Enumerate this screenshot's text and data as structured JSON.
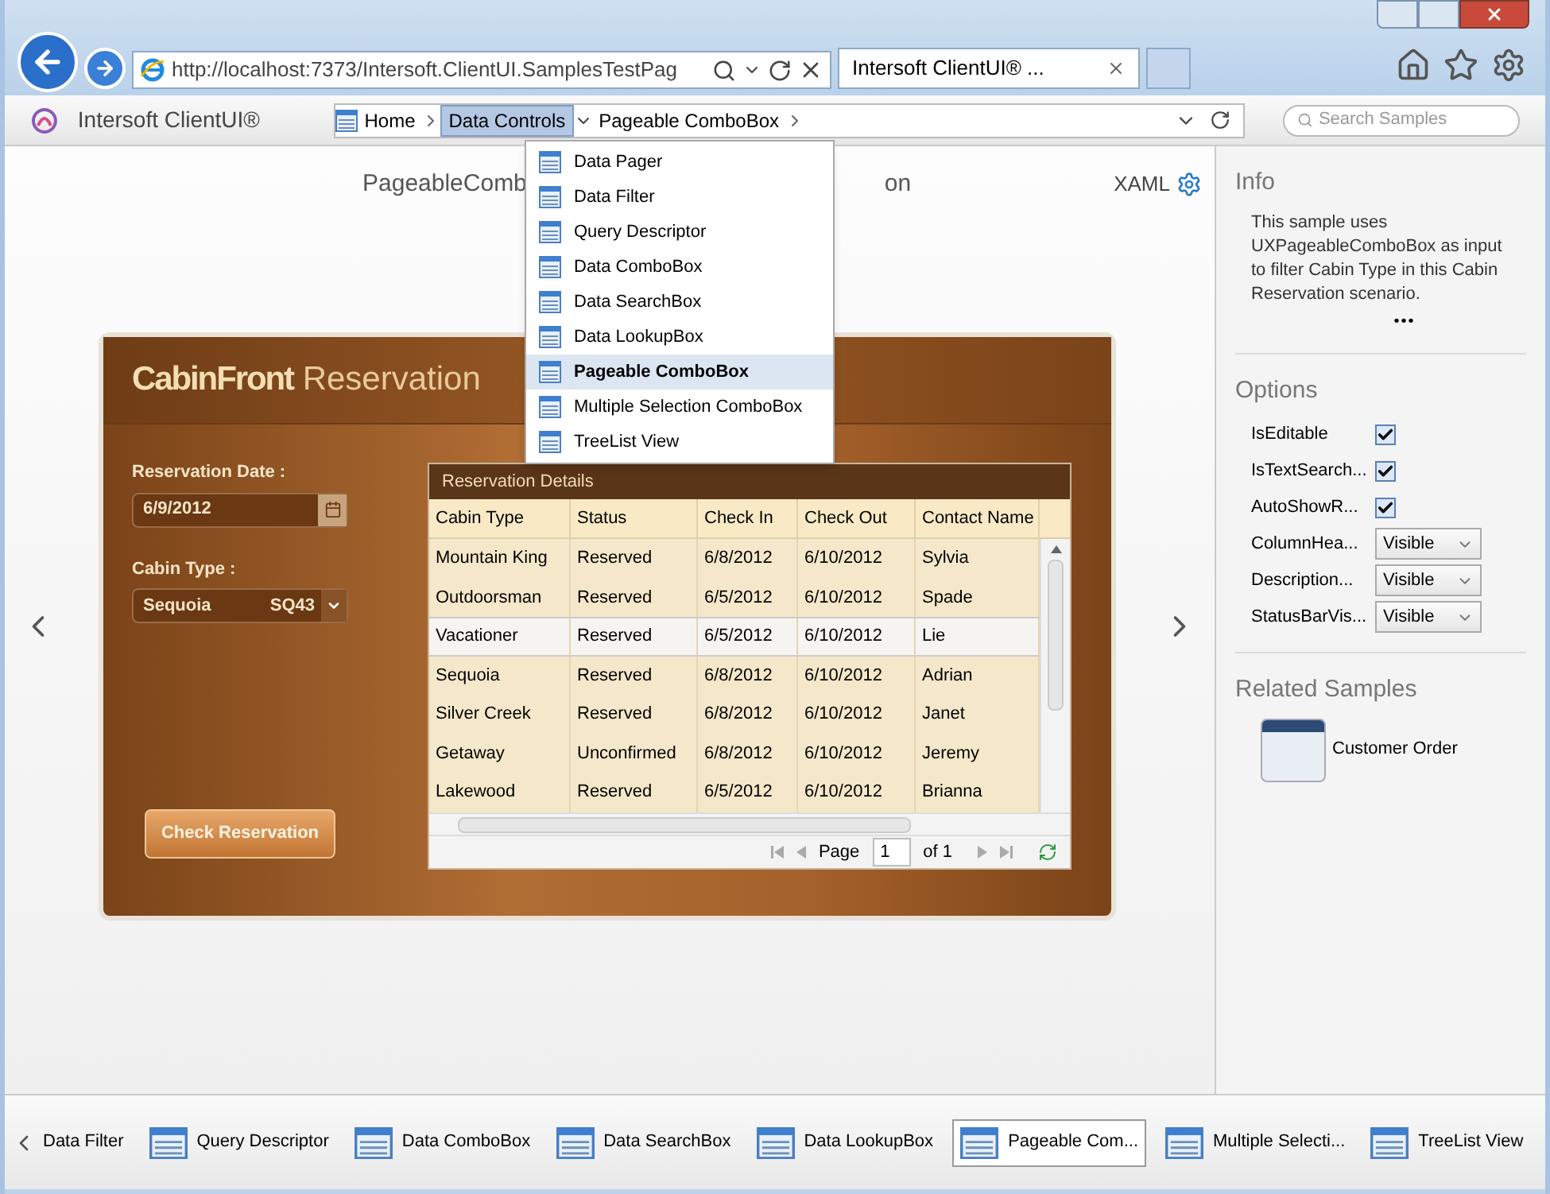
{
  "browser": {
    "url": "http://localhost:7373/Intersoft.ClientUI.SamplesTestPag",
    "tab_title": "Intersoft ClientUI® ..."
  },
  "toolbar": {
    "brand": "Intersoft ClientUI®",
    "breadcrumbs": [
      {
        "label": "Home",
        "selected": false
      },
      {
        "label": "Data Controls",
        "selected": true
      },
      {
        "label": "Pageable ComboBox",
        "selected": false
      }
    ],
    "search_placeholder": "Search Samples"
  },
  "menu": [
    {
      "label": "Data Pager",
      "selected": false
    },
    {
      "label": "Data Filter",
      "selected": false
    },
    {
      "label": "Query Descriptor",
      "selected": false
    },
    {
      "label": "Data ComboBox",
      "selected": false
    },
    {
      "label": "Data SearchBox",
      "selected": false
    },
    {
      "label": "Data LookupBox",
      "selected": false
    },
    {
      "label": "Pageable ComboBox",
      "selected": true
    },
    {
      "label": "Multiple Selection ComboBox",
      "selected": false
    },
    {
      "label": "TreeList View",
      "selected": false
    }
  ],
  "page": {
    "title_start": "PageableComb",
    "title_end": "on",
    "xaml_label": "XAML"
  },
  "reservation": {
    "title_bold": "CabinFront",
    "title_light": "Reservation",
    "date_label": "Reservation Date :",
    "date_value": "6/9/2012",
    "cabin_label": "Cabin Type :",
    "cabin_name": "Sequoia",
    "cabin_code": "SQ43",
    "button": "Check Reservation"
  },
  "grid": {
    "title": "Reservation Details",
    "columns": [
      "Cabin Type",
      "Status",
      "Check In",
      "Check Out",
      "Contact Name"
    ],
    "rows": [
      {
        "cells": [
          "Mountain King",
          "Reserved",
          "6/8/2012",
          "6/10/2012",
          "Sylvia"
        ],
        "selected": false
      },
      {
        "cells": [
          "Outdoorsman",
          "Reserved",
          "6/5/2012",
          "6/10/2012",
          "Spade"
        ],
        "selected": false
      },
      {
        "cells": [
          "Vacationer",
          "Reserved",
          "6/5/2012",
          "6/10/2012",
          "Lie"
        ],
        "selected": true
      },
      {
        "cells": [
          "Sequoia",
          "Reserved",
          "6/8/2012",
          "6/10/2012",
          "Adrian"
        ],
        "selected": false
      },
      {
        "cells": [
          "Silver Creek",
          "Reserved",
          "6/8/2012",
          "6/10/2012",
          "Janet"
        ],
        "selected": false
      },
      {
        "cells": [
          "Getaway",
          "Unconfirmed",
          "6/8/2012",
          "6/10/2012",
          "Jeremy"
        ],
        "selected": false
      },
      {
        "cells": [
          "Lakewood",
          "Reserved",
          "6/5/2012",
          "6/10/2012",
          "Brianna"
        ],
        "selected": false
      }
    ],
    "pager": {
      "page_label": "Page",
      "page_value": "1",
      "of_label": "of 1"
    }
  },
  "side": {
    "info_title": "Info",
    "info_text": "This sample uses UXPageableComboBox as input to filter Cabin Type in this Cabin Reservation scenario.",
    "more": "•••",
    "options_title": "Options",
    "options": [
      {
        "kind": "checkbox",
        "label": "IsEditable",
        "checked": true
      },
      {
        "kind": "checkbox",
        "label": "IsTextSearch...",
        "checked": true
      },
      {
        "kind": "checkbox",
        "label": "AutoShowR...",
        "checked": true
      },
      {
        "kind": "select",
        "label": "ColumnHea...",
        "value": "Visible"
      },
      {
        "kind": "select",
        "label": "Description...",
        "value": "Visible"
      },
      {
        "kind": "select",
        "label": "StatusBarVis...",
        "value": "Visible"
      }
    ],
    "related_title": "Related Samples",
    "related": [
      {
        "label": "Customer Order"
      }
    ]
  },
  "bottom": [
    {
      "label": "Data Filter",
      "selected": false
    },
    {
      "label": "Query Descriptor",
      "selected": false
    },
    {
      "label": "Data ComboBox",
      "selected": false
    },
    {
      "label": "Data SearchBox",
      "selected": false
    },
    {
      "label": "Data LookupBox",
      "selected": false
    },
    {
      "label": "Pageable Com...",
      "selected": true
    },
    {
      "label": "Multiple Selecti...",
      "selected": false
    },
    {
      "label": "TreeList View",
      "selected": false
    }
  ]
}
